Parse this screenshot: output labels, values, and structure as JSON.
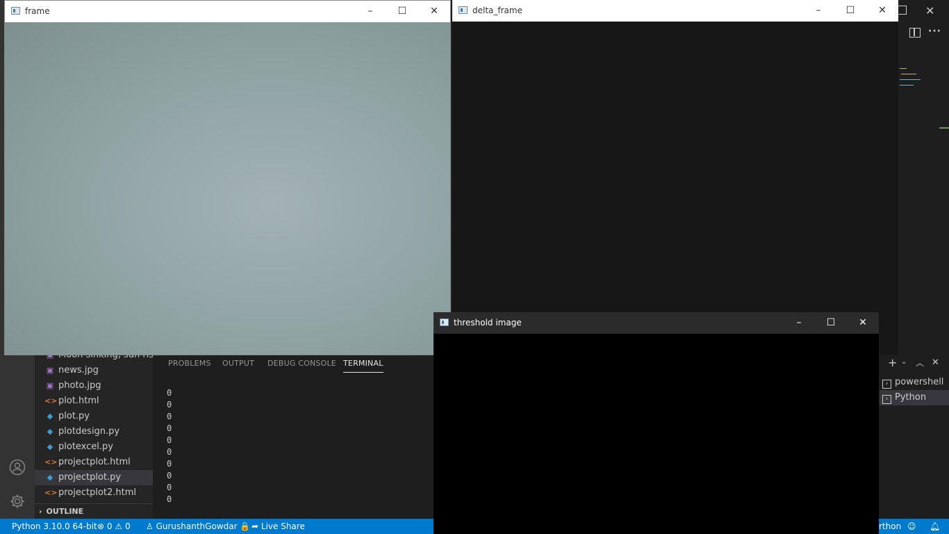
{
  "windows": {
    "frame": {
      "title": "frame"
    },
    "delta": {
      "title": "delta_frame"
    },
    "threshold": {
      "title": "threshold image"
    },
    "controls": {
      "minimize": "–",
      "maximize": "☐",
      "close": "✕"
    }
  },
  "explorer": {
    "files": [
      {
        "name": "Moon sinking, sun risi...",
        "type": "image"
      },
      {
        "name": "news.jpg",
        "type": "image"
      },
      {
        "name": "photo.jpg",
        "type": "image"
      },
      {
        "name": "plot.html",
        "type": "html"
      },
      {
        "name": "plot.py",
        "type": "python"
      },
      {
        "name": "plotdesign.py",
        "type": "python"
      },
      {
        "name": "plotexcel.py",
        "type": "python"
      },
      {
        "name": "projectplot.html",
        "type": "html"
      },
      {
        "name": "projectplot.py",
        "type": "python",
        "selected": true
      },
      {
        "name": "projectplot2.html",
        "type": "html"
      }
    ],
    "outline_label": "OUTLINE"
  },
  "panel": {
    "tabs": [
      "PROBLEMS",
      "OUTPUT",
      "DEBUG CONSOLE",
      "TERMINAL"
    ],
    "active_tab": "TERMINAL",
    "terminal_lines": [
      "0",
      "0",
      "0",
      "0",
      "0",
      "0",
      "0",
      "0",
      "0",
      "0"
    ],
    "terminal_list": [
      "powershell",
      "Python"
    ]
  },
  "statusbar": {
    "interpreter": "Python 3.10.0 64-bit",
    "errors": "0",
    "warnings": "0",
    "user": "GurushanthGowdar",
    "live_share": "Live Share",
    "language_partial": "rthon"
  },
  "colors": {
    "statusbar": "#007acc",
    "frame_content": "#93a5a5",
    "delta_content": "#161616",
    "threshold_content": "#000000"
  }
}
